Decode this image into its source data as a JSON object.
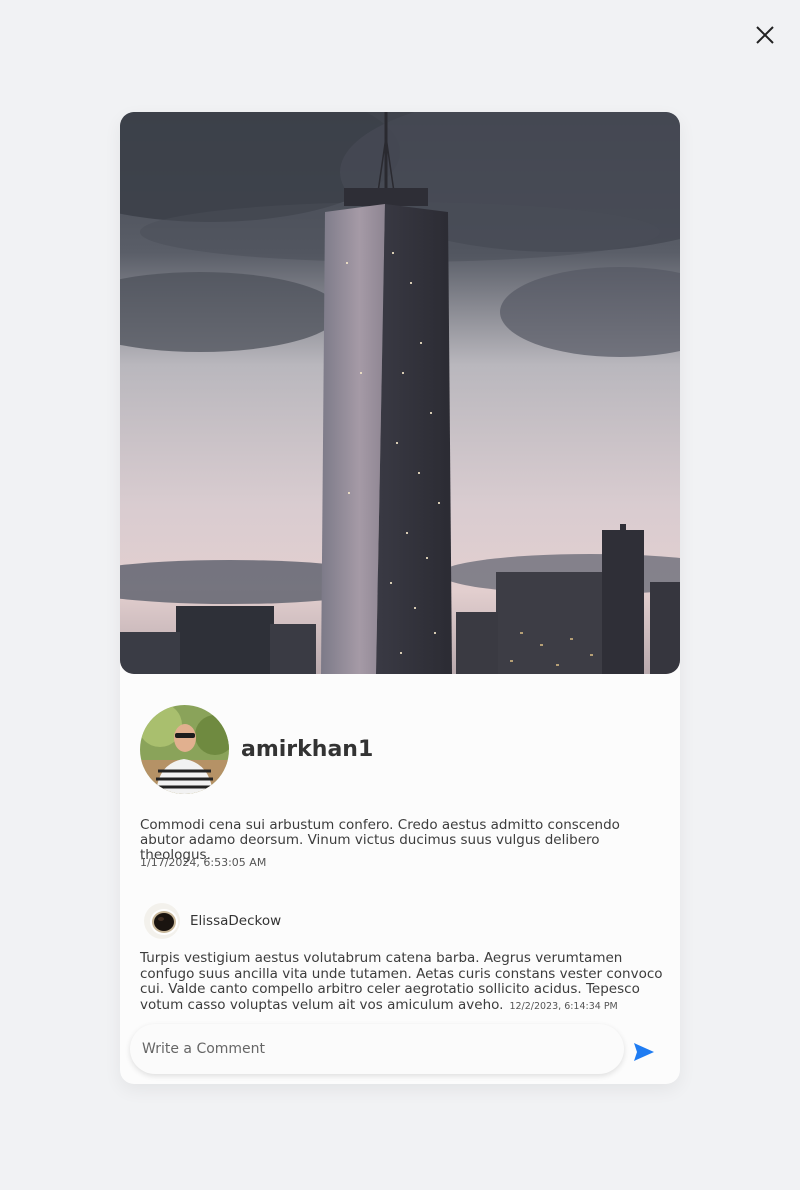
{
  "post": {
    "username": "amirkhan1",
    "caption": "Commodi cena sui arbustum confero. Credo aestus admitto conscendo abutor adamo deorsum. Vinum victus ducimus suus vulgus delibero theologus.",
    "date": "1/17/2024, 6:53:05 AM"
  },
  "comment": {
    "username": "ElissaDeckow",
    "text": "Turpis vestigium aestus volutabrum catena barba. Aegrus verumtamen confugo suus ancilla vita unde tutamen. Aetas curis constans vester convoco cui. Valde canto compello arbitro celer aegrotatio sollicito acidus. Tepesco votum casso voluptas velum ait vos amiculum aveho.",
    "date": "12/2/2023, 6:14:34 PM"
  },
  "comment_form": {
    "placeholder": "Write a Comment"
  },
  "icons": {
    "close": "close-icon",
    "send": "send-icon"
  },
  "colors": {
    "send_accent": "#1f7cf2",
    "background": "#f1f2f4",
    "card": "#fcfcfc"
  }
}
